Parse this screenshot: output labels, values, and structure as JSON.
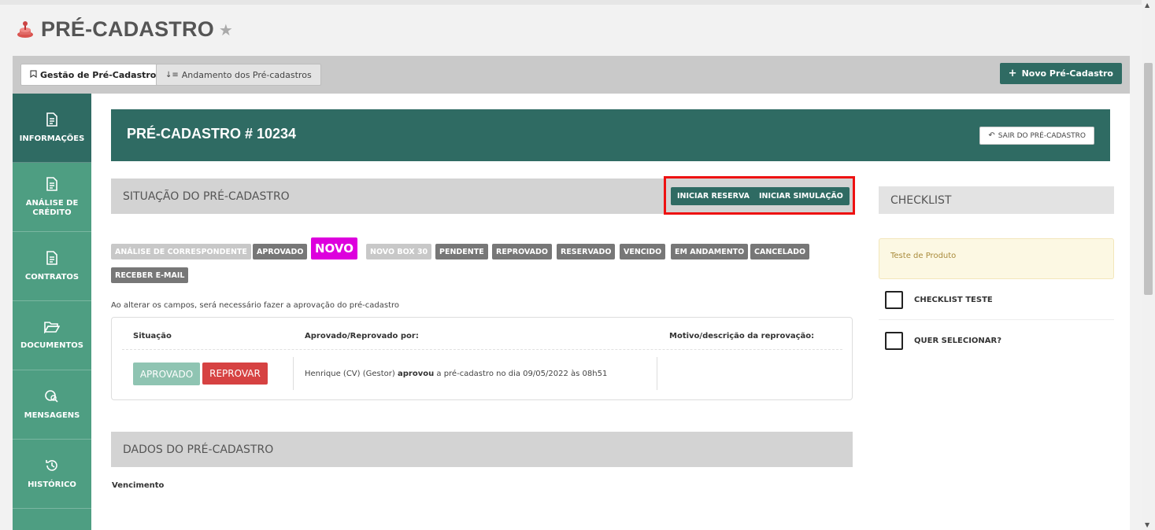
{
  "page": {
    "title": "PRÉ-CADASTRO",
    "star_icon": "star-icon"
  },
  "tabs": [
    {
      "label": "Gestão de Pré-Cadastro",
      "icon": "bookmark-icon"
    },
    {
      "label": "Andamento dos Pré-cadastros",
      "icon": "sort-icon"
    }
  ],
  "new_button": {
    "label": "Novo Pré-Cadastro",
    "icon": "plus-icon"
  },
  "sidebar": {
    "items": [
      {
        "label": "INFORMAÇÕES",
        "icon": "file-icon"
      },
      {
        "label": "ANÁLISE DE CRÉDITO",
        "icon": "file-icon"
      },
      {
        "label": "CONTRATOS",
        "icon": "file-icon"
      },
      {
        "label": "DOCUMENTOS",
        "icon": "folder-open-icon"
      },
      {
        "label": "MENSAGENS",
        "icon": "message-search-icon"
      },
      {
        "label": "HISTÓRICO",
        "icon": "history-icon"
      }
    ]
  },
  "header": {
    "title": "PRÉ-CADASTRO # 10234",
    "exit_label": "SAIR DO PRÉ-CADASTRO"
  },
  "situacao": {
    "title": "SITUAÇÃO DO PRÉ-CADASTRO",
    "btn_reserva": "INICIAR RESERVA",
    "btn_simulacao": "INICIAR SIMULAÇÃO",
    "statuses": [
      "ANÁLISE DE CORRESPONDENTE",
      "APROVADO",
      "NOVO",
      "NOVO BOX 30",
      "PENDENTE",
      "REPROVADO",
      "RESERVADO",
      "VENCIDO",
      "EM ANDAMENTO",
      "CANCELADO",
      "RECEBER E-MAIL"
    ],
    "note": "Ao alterar os campos, será necessário fazer a aprovação do pré-cadastro",
    "table": {
      "col_situacao": "Situação",
      "col_aprovado": "Aprovado/Reprovado por:",
      "col_motivo": "Motivo/descrição da reprovação:",
      "btn_aprovado": "APROVADO",
      "btn_reprovar": "REPROVAR",
      "approved_by": "Henrique (CV) (Gestor)",
      "approved_action": "aprovou",
      "approved_rest": "a pré-cadastro no dia 09/05/2022 às 08h51"
    }
  },
  "dados": {
    "title": "DADOS DO PRÉ-CADASTRO",
    "vencimento": "Vencimento"
  },
  "checklist": {
    "title": "CHECKLIST",
    "alert": "Teste de Produto",
    "items": [
      "CHECKLIST TESTE",
      "QUER SELECIONAR?"
    ]
  },
  "colors": {
    "brand": "#2f6b63",
    "sidebar": "#4e9e82",
    "danger": "#d64242",
    "highlight": "#ee1111",
    "novo": "#dd00dd"
  }
}
